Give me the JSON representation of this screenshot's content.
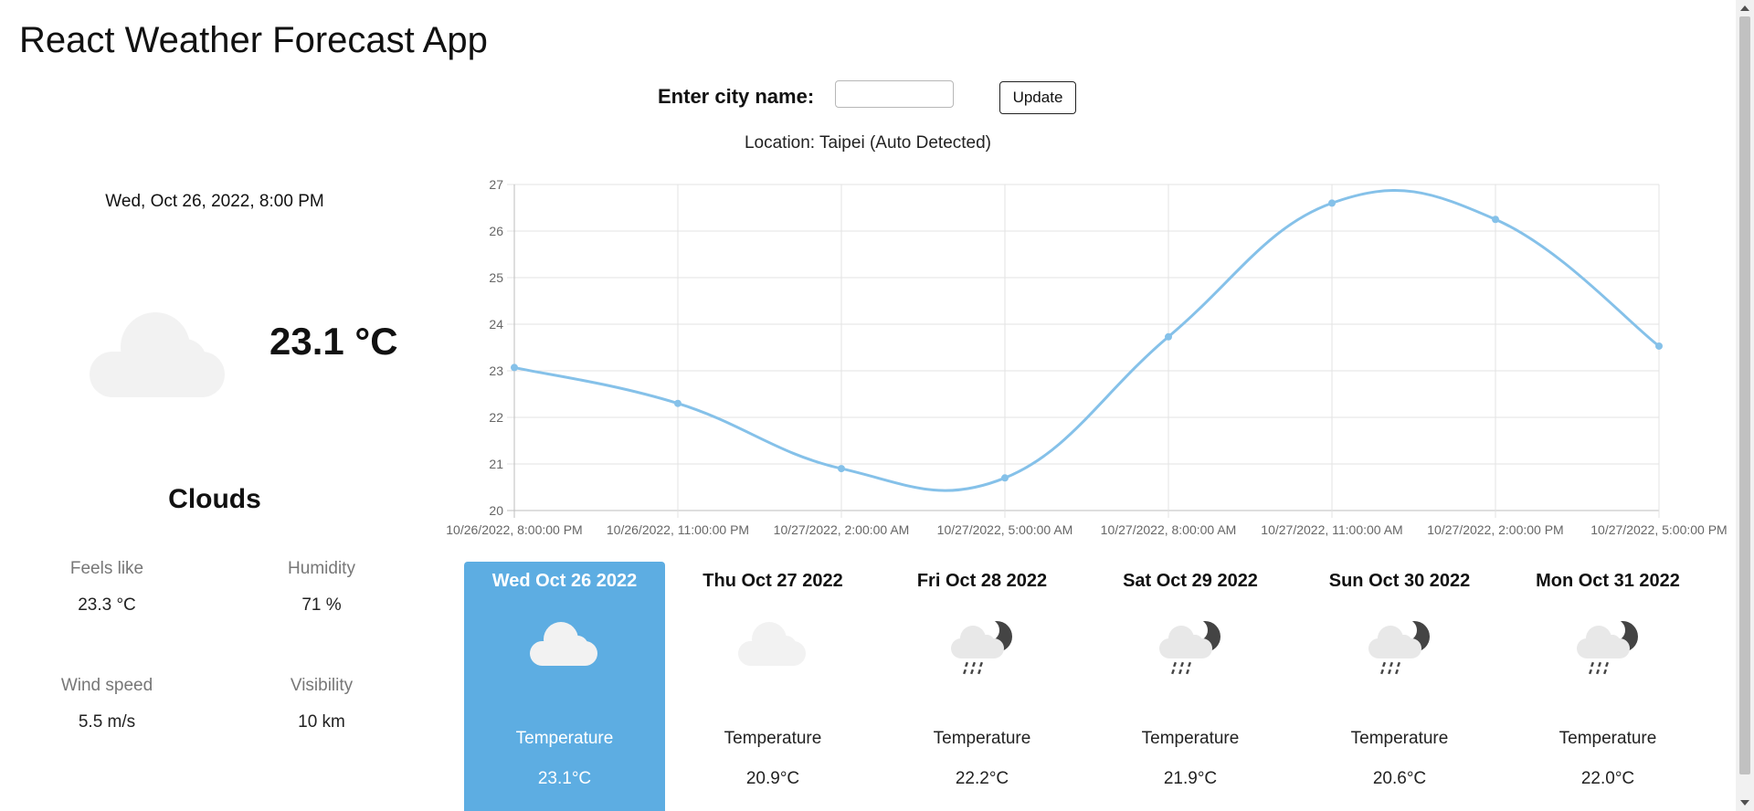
{
  "app": {
    "title": "React Weather Forecast App"
  },
  "search": {
    "label": "Enter city name:",
    "value": "",
    "placeholder": "",
    "button_label": "Update"
  },
  "location": {
    "text": "Location: Taipei (Auto Detected)"
  },
  "current": {
    "datetime": "Wed, Oct 26, 2022, 8:00 PM",
    "icon": "cloud-icon",
    "temperature": "23.1 °C",
    "condition": "Clouds",
    "stats": [
      {
        "label": "Feels like",
        "value": "23.3 °C"
      },
      {
        "label": "Humidity",
        "value": "71 %"
      },
      {
        "label": "Wind speed",
        "value": "5.5 m/s"
      },
      {
        "label": "Visibility",
        "value": "10 km"
      }
    ]
  },
  "chart_data": {
    "type": "line",
    "title": "",
    "xlabel": "",
    "ylabel": "",
    "ylim": [
      20,
      27
    ],
    "y_ticks": [
      "20",
      "21",
      "22",
      "23",
      "24",
      "25",
      "26",
      "27"
    ],
    "categories": [
      "10/26/2022, 8:00:00 PM",
      "10/26/2022, 11:00:00 PM",
      "10/27/2022, 2:00:00 AM",
      "10/27/2022, 5:00:00 AM",
      "10/27/2022, 8:00:00 AM",
      "10/27/2022, 11:00:00 AM",
      "10/27/2022, 2:00:00 PM",
      "10/27/2022, 5:00:00 PM"
    ],
    "values": [
      23.07,
      22.3,
      20.9,
      20.7,
      23.73,
      26.6,
      26.25,
      23.53
    ],
    "grid": true,
    "legend": "none",
    "line_color": "#85c1e9"
  },
  "forecast": [
    {
      "day": "Wed Oct 26 2022",
      "icon": "cloud-icon",
      "temp_label": "Temperature",
      "temp": "23.1°C",
      "active": true
    },
    {
      "day": "Thu Oct 27 2022",
      "icon": "cloud-icon",
      "temp_label": "Temperature",
      "temp": "20.9°C",
      "active": false
    },
    {
      "day": "Fri Oct 28 2022",
      "icon": "night-rain-icon",
      "temp_label": "Temperature",
      "temp": "22.2°C",
      "active": false
    },
    {
      "day": "Sat Oct 29 2022",
      "icon": "night-rain-icon",
      "temp_label": "Temperature",
      "temp": "21.9°C",
      "active": false
    },
    {
      "day": "Sun Oct 30 2022",
      "icon": "night-rain-icon",
      "temp_label": "Temperature",
      "temp": "20.6°C",
      "active": false
    },
    {
      "day": "Mon Oct 31 2022",
      "icon": "night-rain-icon",
      "temp_label": "Temperature",
      "temp": "22.0°C",
      "active": false
    }
  ],
  "colors": {
    "active_card": "#5dade2",
    "cloud": "#f2f2f2",
    "moon": "#444444"
  }
}
